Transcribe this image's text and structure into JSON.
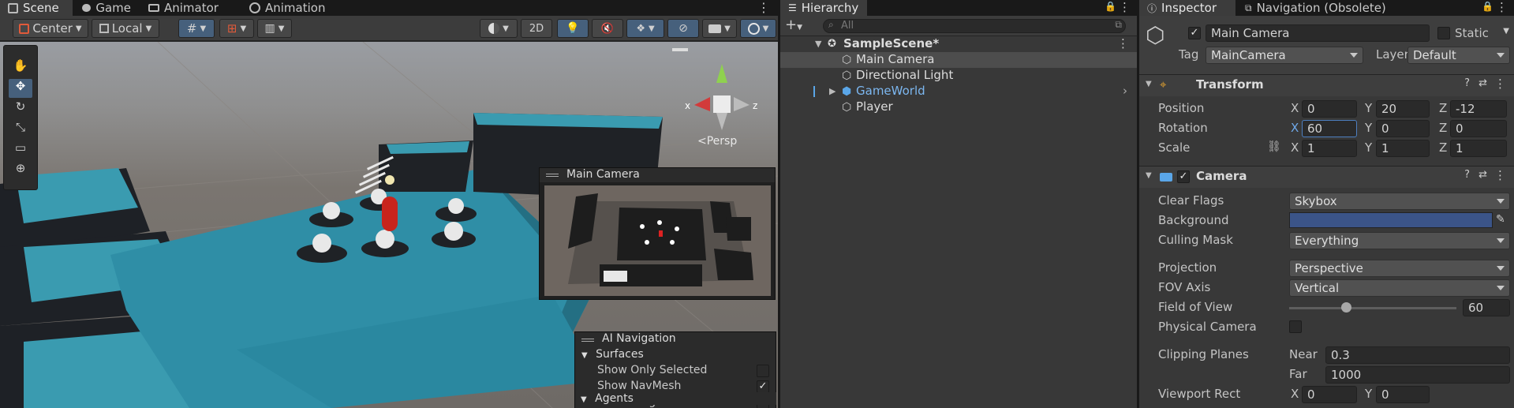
{
  "scene_tabs": [
    {
      "label": "Scene",
      "icon": "scene-icon"
    },
    {
      "label": "Game",
      "icon": "game-controller-icon"
    },
    {
      "label": "Animator",
      "icon": "animator-icon"
    },
    {
      "label": "Animation",
      "icon": "clock-icon"
    }
  ],
  "scene_toolbar": {
    "pivot": "Center",
    "space": "Local",
    "mode_2d": "2D"
  },
  "gizmo": {
    "persp_label": "<Persp",
    "x": "x",
    "z": "z"
  },
  "camera_preview": {
    "title": "Main Camera"
  },
  "ai_nav": {
    "title": "AI Navigation",
    "surfaces": "Surfaces",
    "options": [
      {
        "label": "Show Only Selected",
        "checked": false
      },
      {
        "label": "Show NavMesh",
        "checked": true
      },
      {
        "label": "Show HeightMesh",
        "checked": false
      }
    ],
    "agents": "Agents"
  },
  "hierarchy": {
    "tab": "Hierarchy",
    "search_placeholder": "All",
    "scene": "SampleScene*",
    "items": [
      {
        "label": "Main Camera",
        "selected": true
      },
      {
        "label": "Directional Light",
        "selected": false
      },
      {
        "label": "GameWorld",
        "selected": false,
        "prefab": true
      },
      {
        "label": "Player",
        "selected": false
      }
    ]
  },
  "inspector": {
    "tabs": [
      "Inspector",
      "Navigation (Obsolete)"
    ],
    "object_name": "Main Camera",
    "static_label": "Static",
    "tag_label": "Tag",
    "tag_value": "MainCamera",
    "layer_label": "Layer",
    "layer_value": "Default",
    "transform": {
      "title": "Transform",
      "position_label": "Position",
      "rotation_label": "Rotation",
      "scale_label": "Scale",
      "position": {
        "x": "0",
        "y": "20",
        "z": "-12"
      },
      "rotation": {
        "x": "60",
        "y": "0",
        "z": "0"
      },
      "scale": {
        "x": "1",
        "y": "1",
        "z": "1"
      }
    },
    "camera": {
      "title": "Camera",
      "clear_flags_label": "Clear Flags",
      "clear_flags": "Skybox",
      "background_label": "Background",
      "background_color": "#3b5488",
      "culling_mask_label": "Culling Mask",
      "culling_mask": "Everything",
      "projection_label": "Projection",
      "projection": "Perspective",
      "fov_axis_label": "FOV Axis",
      "fov_axis": "Vertical",
      "fov_label": "Field of View",
      "fov_value": "60",
      "physical_label": "Physical Camera",
      "clipping_label": "Clipping Planes",
      "near_label": "Near",
      "near": "0.3",
      "far_label": "Far",
      "far": "1000",
      "viewport_label": "Viewport Rect",
      "viewport_x": "0",
      "viewport_y": "0"
    }
  },
  "axis_labels": {
    "x": "X",
    "y": "Y",
    "z": "Z"
  }
}
